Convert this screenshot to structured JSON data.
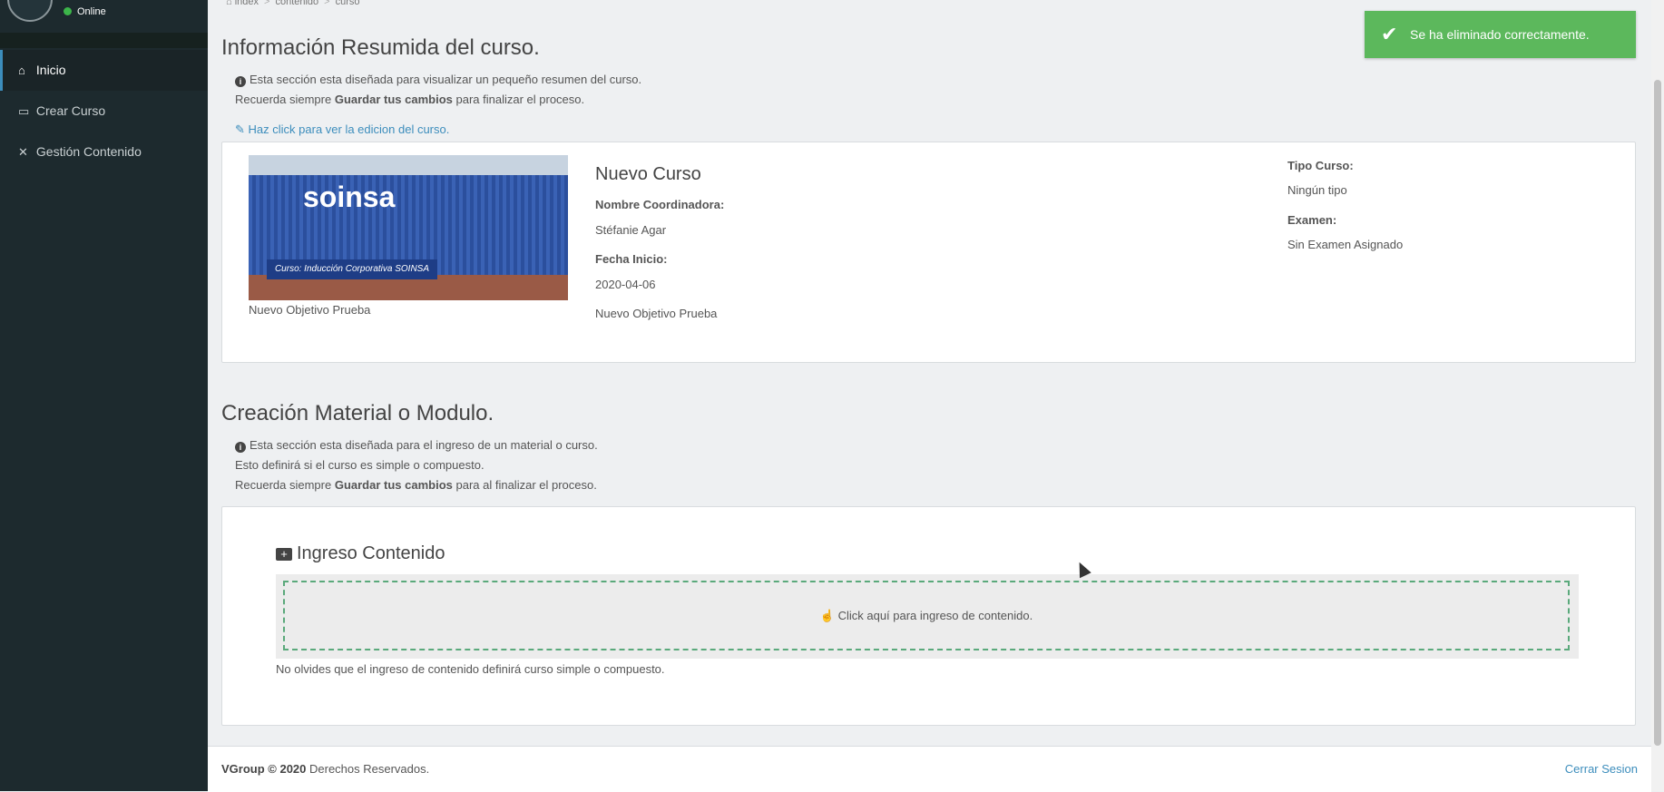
{
  "sidebar": {
    "status": "Online",
    "items": [
      {
        "icon": "home-icon",
        "glyph": "⌂",
        "label": "Inicio",
        "active": true
      },
      {
        "icon": "laptop-icon",
        "glyph": "▭",
        "label": "Crear Curso",
        "active": false
      },
      {
        "icon": "tools-icon",
        "glyph": "✕",
        "label": "Gestión Contenido",
        "active": false
      }
    ]
  },
  "breadcrumb": [
    "index",
    "contenido",
    "curso"
  ],
  "summary": {
    "title": "Información Resumida del curso.",
    "note1": "Esta sección esta diseñada para visualizar un pequeño resumen del curso.",
    "note2_pre": "Recuerda siempre ",
    "note2_bold": "Guardar tus cambios",
    "note2_post": " para finalizar el proceso.",
    "edit_link": "Haz click para ver la edicion del curso."
  },
  "course": {
    "image_logo": "soinsa",
    "image_banner": "Curso: Inducción Corporativa SOINSA",
    "image_caption": "Nuevo Objetivo Prueba",
    "name": "Nuevo Curso",
    "coordinator_label": "Nombre Coordinadora:",
    "coordinator": "Stéfanie Agar",
    "start_label": "Fecha Inicio:",
    "start_date": "2020-04-06",
    "objective": "Nuevo Objetivo Prueba",
    "type_label": "Tipo Curso:",
    "type": "Ningún tipo",
    "exam_label": "Examen:",
    "exam": "Sin Examen Asignado"
  },
  "creation": {
    "title": "Creación Material o Modulo.",
    "note1": "Esta sección esta diseñada para el ingreso de un material o curso.",
    "note2": "Esto definirá si el curso es simple o compuesto.",
    "note3_pre": "Recuerda siempre ",
    "note3_bold": "Guardar tus cambios",
    "note3_post": " para al finalizar el proceso.",
    "content_title": "Ingreso Contenido",
    "drop_label": "Click aquí para ingreso de contenido.",
    "drop_note": "No olvides que el ingreso de contenido definirá curso simple o compuesto."
  },
  "footer": {
    "brand": "VGroup © 2020",
    "rights": " Derechos Reservados.",
    "logout": "Cerrar Sesion"
  },
  "toast": {
    "message": "Se ha eliminado correctamente."
  },
  "colors": {
    "sidebar": "#1d2a2e",
    "link": "#3c8dbc",
    "success": "#5cb85c"
  }
}
